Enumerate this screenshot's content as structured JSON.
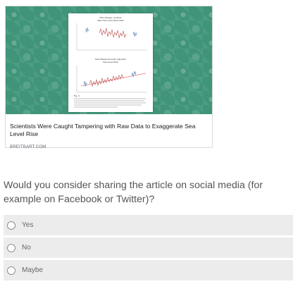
{
  "article": {
    "title": "Scientists Were Caught Tampering with Raw Data to Exaggerate Sea Level Rise",
    "source": "BREITBART.COM",
    "figure": {
      "top_title_1": "Tide Gauges, Austral.",
      "top_title_2": "Raw Sea Level Rise Data",
      "bottom_title_1": "Raw Measurements Adjusted",
      "bottom_title_2": "Sea Level Rise",
      "caption_label": "Fig. 4"
    }
  },
  "survey": {
    "question": "Would you consider sharing the article on social media (for example on Facebook or Twitter)?",
    "options": [
      {
        "label": "Yes"
      },
      {
        "label": "No"
      },
      {
        "label": "Maybe"
      }
    ]
  },
  "colors": {
    "image_background": "#3f9479",
    "option_background": "#ececec"
  }
}
